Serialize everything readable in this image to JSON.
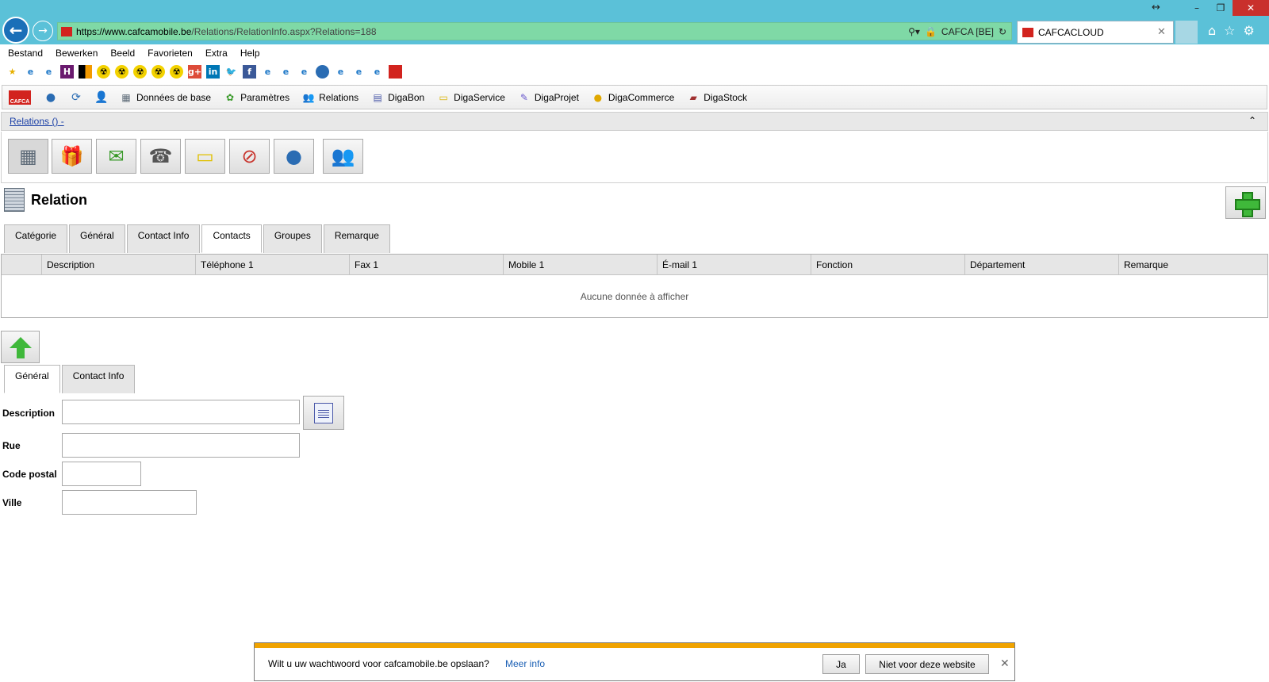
{
  "browser": {
    "url_host": "https://www.cafcamobile.be",
    "url_path": "/Relations/RelationInfo.aspx?Relations=188",
    "site_name": "CAFCA [BE]",
    "tab_title": "CAFCACLOUD"
  },
  "menu": [
    "Bestand",
    "Bewerken",
    "Beeld",
    "Favorieten",
    "Extra",
    "Help"
  ],
  "app_nav": {
    "logo_text": "CAFCA",
    "items": [
      "Données de base",
      "Paramètres",
      "Relations",
      "DigaBon",
      "DigaService",
      "DigaProjet",
      "DigaCommerce",
      "DigaStock"
    ]
  },
  "breadcrumb": "Relations () -",
  "page_title": "Relation",
  "top_tabs": [
    "Catégorie",
    "Général",
    "Contact Info",
    "Contacts",
    "Groupes",
    "Remarque"
  ],
  "grid": {
    "columns": [
      "Description",
      "Téléphone 1",
      "Fax 1",
      "Mobile 1",
      "É-mail 1",
      "Fonction",
      "Département",
      "Remarque"
    ],
    "empty_text": "Aucune donnée à afficher"
  },
  "sub_tabs": [
    "Général",
    "Contact Info"
  ],
  "form": {
    "description_label": "Description",
    "rue_label": "Rue",
    "code_postal_label": "Code postal",
    "ville_label": "Ville",
    "description_value": "",
    "rue_value": "",
    "code_postal_value": "",
    "ville_value": ""
  },
  "notification": {
    "text": "Wilt u uw wachtwoord voor cafcamobile.be opslaan?",
    "link": "Meer info",
    "yes_label": "Ja",
    "no_label": "Niet voor deze website"
  },
  "colors": {
    "titlebar": "#5bc1d8",
    "addressbar": "#7fd9a6",
    "accent_orange": "#f0a300"
  }
}
